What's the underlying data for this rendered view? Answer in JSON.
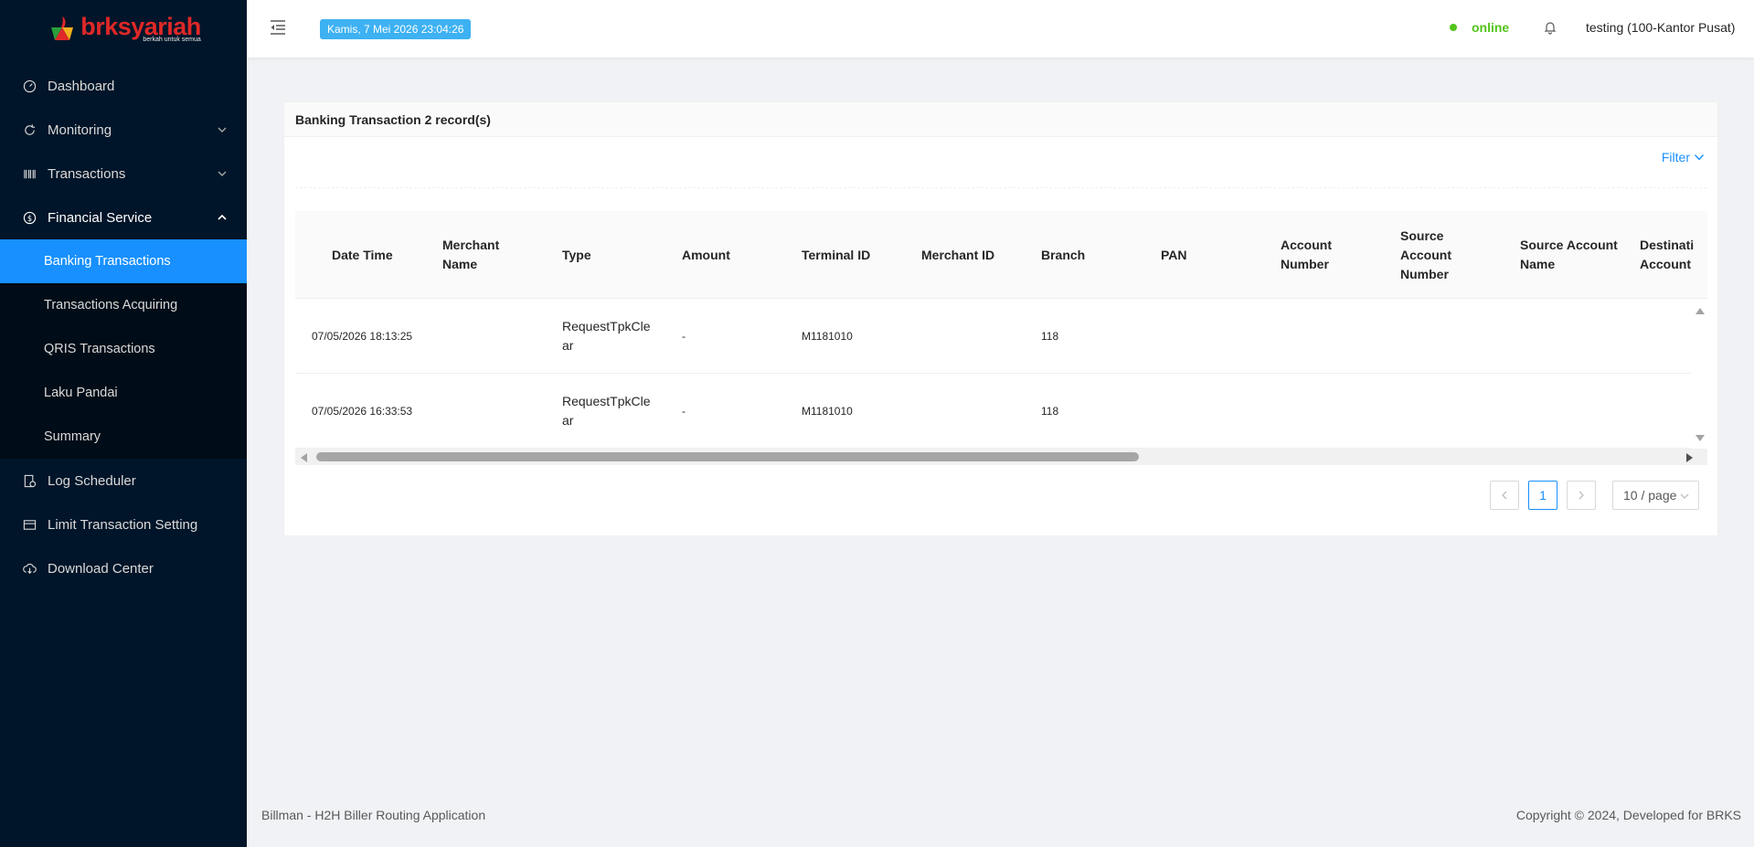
{
  "logo": {
    "text": "brksyariah",
    "tagline": "berkah untuk semua"
  },
  "sidebar": {
    "items": [
      {
        "label": "Dashboard"
      },
      {
        "label": "Monitoring"
      },
      {
        "label": "Transactions"
      },
      {
        "label": "Financial Service"
      },
      {
        "label": "Log Scheduler"
      },
      {
        "label": "Limit Transaction Setting"
      },
      {
        "label": "Download Center"
      }
    ],
    "submenu": [
      {
        "label": "Banking Transactions"
      },
      {
        "label": "Transactions Acquiring"
      },
      {
        "label": "QRIS Transactions"
      },
      {
        "label": "Laku Pandai"
      },
      {
        "label": "Summary"
      }
    ]
  },
  "header": {
    "datetime": "Kamis, 7 Mei 2026 23:04:26",
    "status": "online",
    "user": "testing (100-Kantor Pusat)"
  },
  "card": {
    "title": "Banking Transaction 2 record(s)",
    "filter_label": "Filter"
  },
  "table": {
    "columns": [
      "Date Time",
      "Merchant Name",
      "Type",
      "Amount",
      "Terminal ID",
      "Merchant ID",
      "Branch",
      "PAN",
      "Account Number",
      "Source Account Number",
      "Source Account Name",
      "Destinati Account"
    ],
    "rows": [
      {
        "datetime": "07/05/2026 18:13:25",
        "merchant_name": "",
        "type": "RequestTpkClear",
        "amount": "-",
        "terminal_id": "M1181010",
        "merchant_id": "",
        "branch": "118",
        "pan": "",
        "account_number": "",
        "source_account_number": "",
        "source_account_name": "",
        "destination_account": ""
      },
      {
        "datetime": "07/05/2026 16:33:53",
        "merchant_name": "",
        "type": "RequestTpkClear",
        "amount": "-",
        "terminal_id": "M1181010",
        "merchant_id": "",
        "branch": "118",
        "pan": "",
        "account_number": "",
        "source_account_number": "",
        "source_account_name": "",
        "destination_account": ""
      }
    ]
  },
  "pagination": {
    "current_page": "1",
    "page_size": "10 / page"
  },
  "footer": {
    "left": "Billman - H2H Biller Routing Application",
    "right": "Copyright © 2024, Developed for BRKS"
  },
  "colors": {
    "sidebar_bg": "#001529",
    "accent": "#1890ff",
    "online": "#52c41a",
    "badge": "#3db1f2",
    "brand_red": "#e02828"
  }
}
